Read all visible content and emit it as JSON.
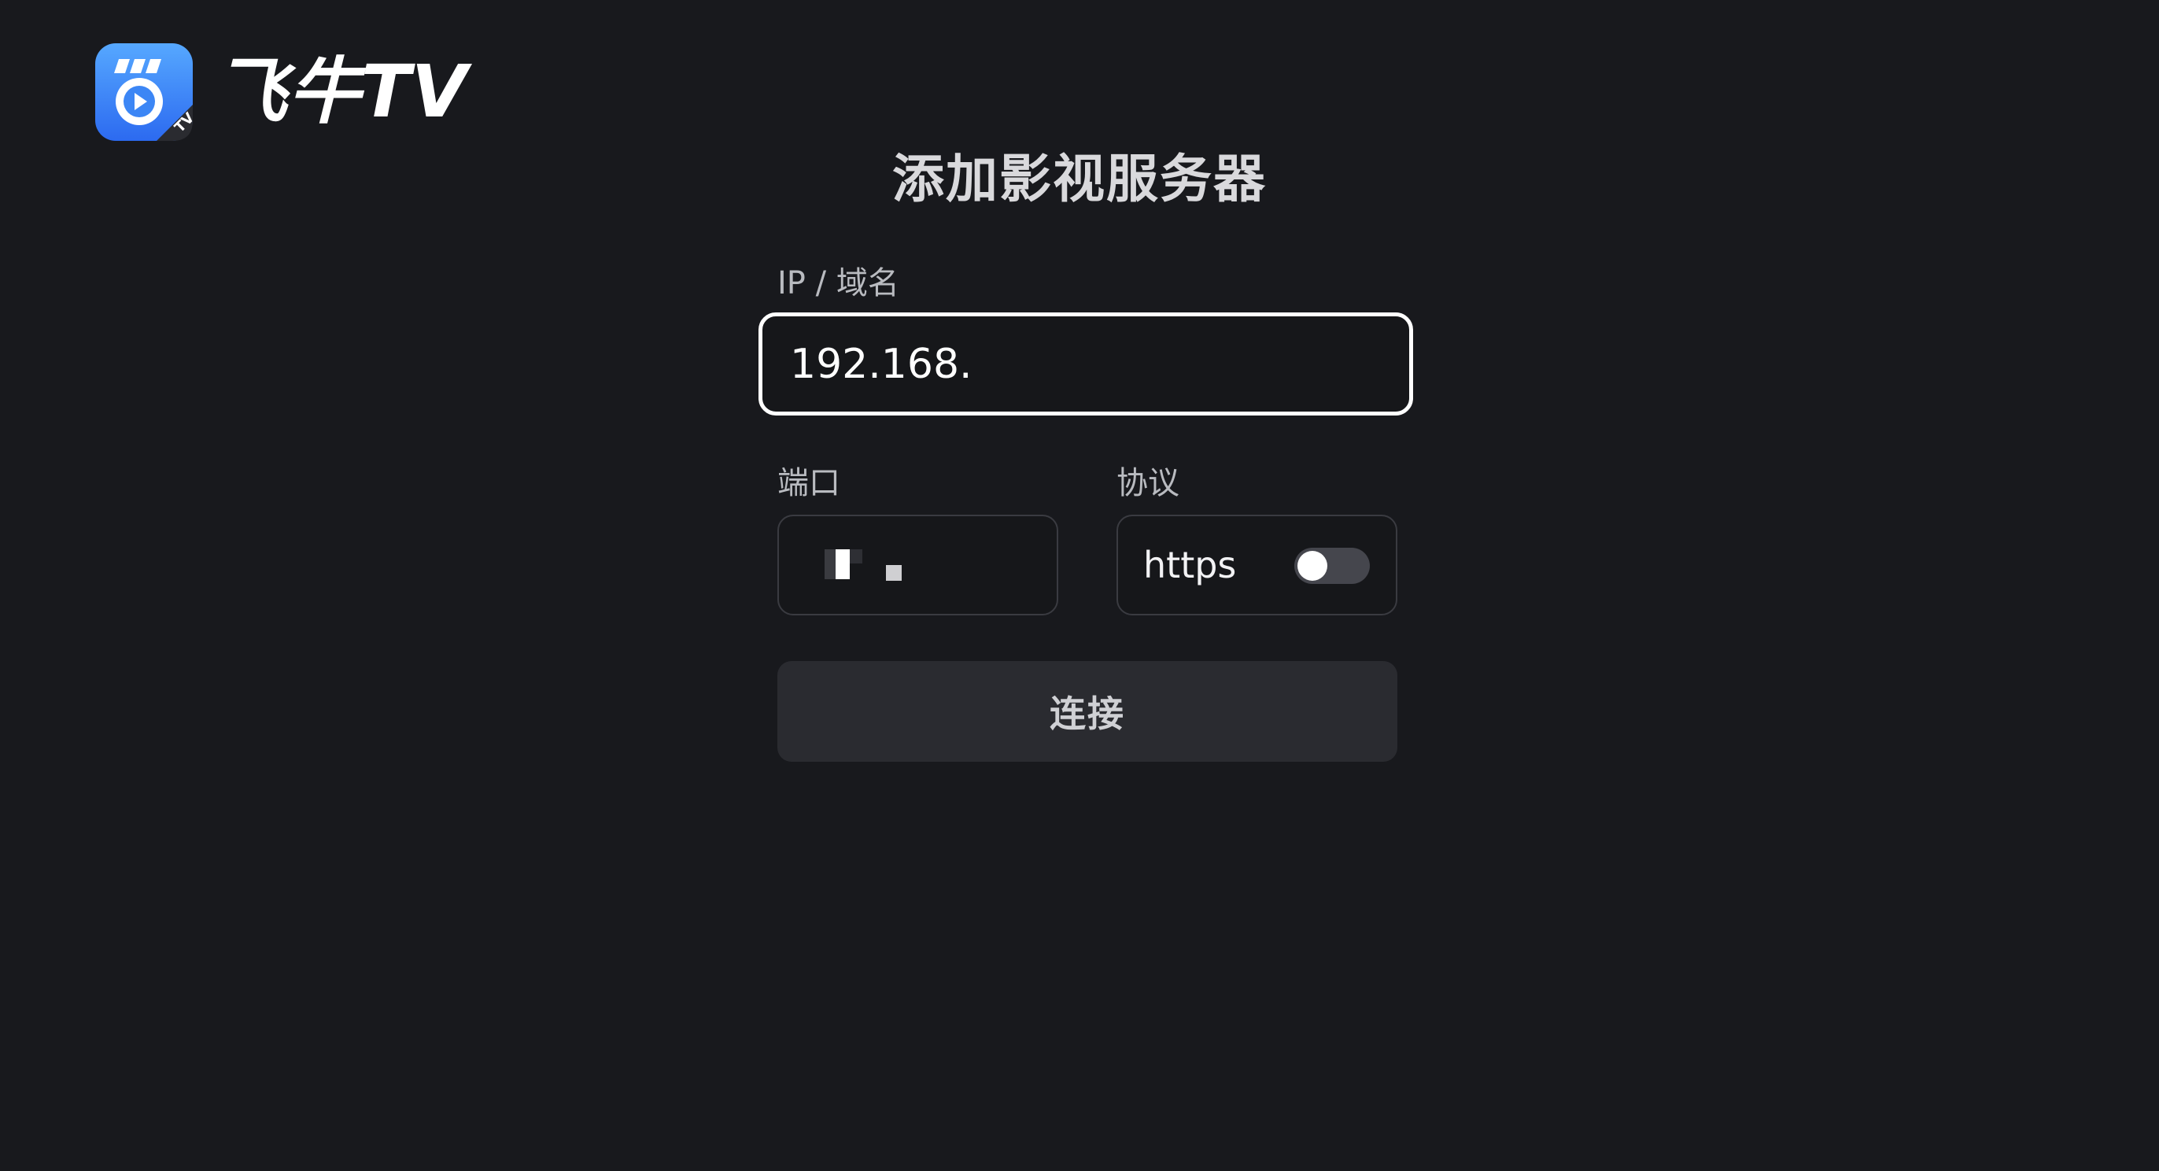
{
  "app": {
    "name": "飞牛TV",
    "icon_badge": "TV",
    "icon": "feiniu-tv-logo-icon"
  },
  "page": {
    "title": "添加影视服务器"
  },
  "form": {
    "ip": {
      "label": "IP / 域名",
      "value": "192.168."
    },
    "port": {
      "label": "端口",
      "value": ""
    },
    "protocol": {
      "label": "协议",
      "option": "https",
      "enabled": false
    },
    "connect_label": "连接"
  },
  "colors": {
    "background": "#18191d",
    "focus_border": "#ffffff",
    "icon_gradient_top": "#4fa3ff",
    "icon_gradient_bottom": "#2d6cf0"
  }
}
